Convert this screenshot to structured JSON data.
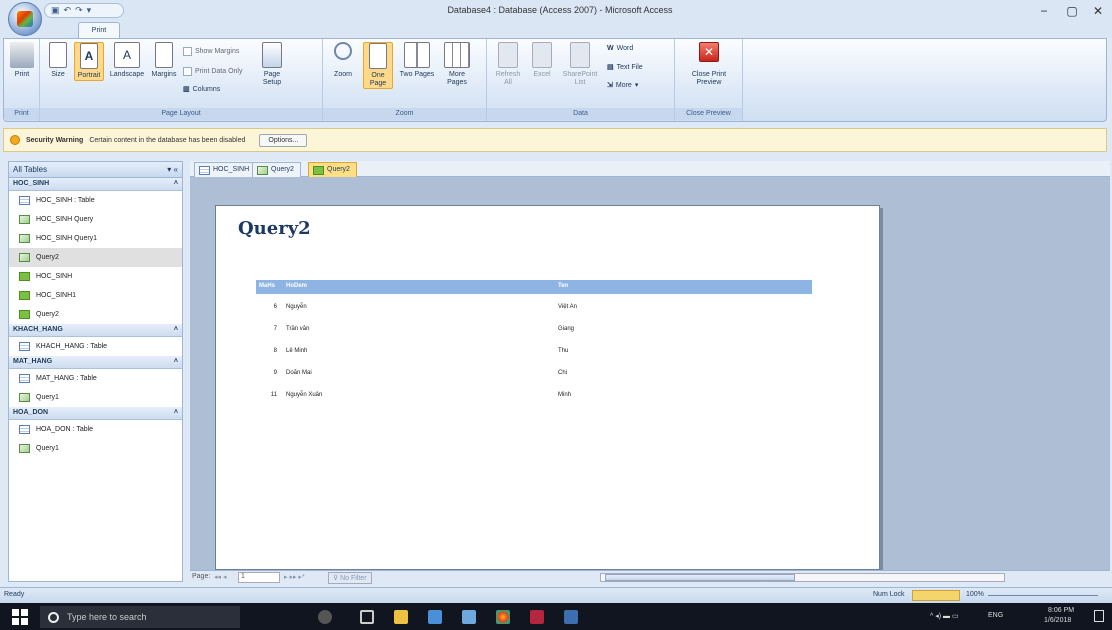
{
  "window": {
    "title": "Database4 : Database (Access 2007) - Microsoft Access",
    "minimize": "−",
    "restore": "▢",
    "close": "✕"
  },
  "qat": {
    "items": [
      "▣",
      "↶",
      "↷",
      "▾"
    ]
  },
  "ribbon_tab": "Print Preview",
  "groups": {
    "print": {
      "label": "Print",
      "buttons": {
        "print": "Print"
      }
    },
    "page_layout": {
      "label": "Page Layout",
      "buttons": {
        "size": "Size",
        "portrait": "Portrait",
        "landscape": "Landscape",
        "margins": "Margins",
        "show_margins": "Show Margins",
        "print_data_only": "Print Data Only",
        "columns": "Columns",
        "page_setup": "Page Setup"
      }
    },
    "zoom": {
      "label": "Zoom",
      "buttons": {
        "zoom": "Zoom",
        "one_page": "One Page",
        "two_pages": "Two Pages",
        "more_pages": "More Pages"
      }
    },
    "data": {
      "label": "Data",
      "buttons": {
        "refresh": "Refresh All",
        "excel": "Excel",
        "sharepoint": "SharePoint List",
        "word": "Word",
        "text_file": "Text File",
        "more": "More"
      }
    },
    "close_preview": {
      "label": "Close Preview",
      "buttons": {
        "close": "Close Print Preview"
      }
    }
  },
  "security": {
    "title": "Security Warning",
    "message": "Certain content in the database has been disabled",
    "options": "Options..."
  },
  "nav": {
    "header": "All Tables",
    "groups": [
      {
        "name": "HOC_SINH",
        "items": [
          {
            "label": "HOC_SINH : Table",
            "type": "table"
          },
          {
            "label": "HOC_SINH Query",
            "type": "query"
          },
          {
            "label": "HOC_SINH Query1",
            "type": "query"
          },
          {
            "label": "Query2",
            "type": "query",
            "selected": true
          },
          {
            "label": "HOC_SINH",
            "type": "form"
          },
          {
            "label": "HOC_SINH1",
            "type": "form"
          },
          {
            "label": "Query2",
            "type": "form"
          }
        ]
      },
      {
        "name": "KHACH_HANG",
        "items": [
          {
            "label": "KHACH_HANG : Table",
            "type": "table"
          }
        ]
      },
      {
        "name": "MAT_HANG",
        "items": [
          {
            "label": "MAT_HANG : Table",
            "type": "table"
          },
          {
            "label": "Query1",
            "type": "query"
          }
        ]
      },
      {
        "name": "HOA_DON",
        "items": [
          {
            "label": "HOA_DON : Table",
            "type": "table"
          },
          {
            "label": "Query1",
            "type": "query"
          }
        ]
      }
    ]
  },
  "doc_tabs": [
    {
      "label": "HOC_SINH",
      "type": "table"
    },
    {
      "label": "Query2",
      "type": "query"
    },
    {
      "label": "Query2",
      "type": "form",
      "active": true
    }
  ],
  "report": {
    "title": "Query2",
    "columns": [
      "MaHs",
      "HoDem",
      "Ten"
    ],
    "rows": [
      [
        "6",
        "Nguyễn",
        "Việt An"
      ],
      [
        "7",
        "Trần văn",
        "Giang"
      ],
      [
        "8",
        "Lê Minh",
        "Thu"
      ],
      [
        "9",
        "Doãn Mai",
        "Chi"
      ],
      [
        "11",
        "Nguyễn Xuân",
        "Minh"
      ]
    ]
  },
  "record_nav": {
    "page_label": "Page:",
    "page_value": "1",
    "filter": "No Filter"
  },
  "status": {
    "left": "Ready",
    "num_lock": "Num Lock",
    "zoom": "100%"
  },
  "taskbar": {
    "search_placeholder": "Type here to search",
    "lang": "ENG",
    "time": "8:06 PM",
    "date": "1/6/2018"
  }
}
